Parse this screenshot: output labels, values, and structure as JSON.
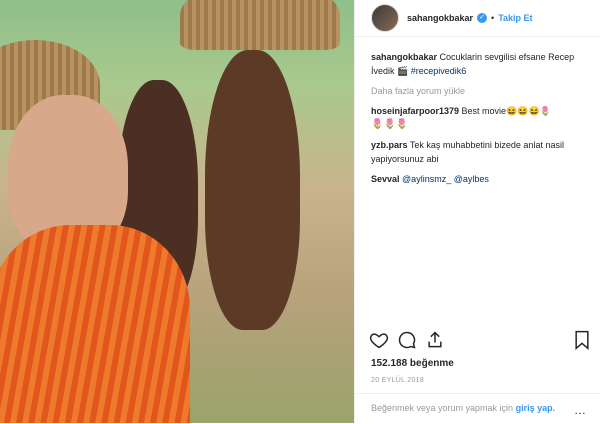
{
  "header": {
    "username": "sahangokbakar",
    "follow_label": "Takip Et"
  },
  "caption": {
    "username": "sahangokbakar",
    "text": "Cocuklarin sevgilisi efsane Recep İvedik",
    "emoji": "🎬",
    "hashtag": "#recepivedik6"
  },
  "load_more_label": "Daha fazla yorum yükle",
  "comments": [
    {
      "username": "hoseinjafarpoor1379",
      "text": "Best movie😆😆😆🌷",
      "extra": "🌷🌷🌷"
    },
    {
      "username": "yzb.pars",
      "text": "Tek kaş muhabbetini bizede anlat nasil yapiyorsunuz abi"
    },
    {
      "username": "Sevval",
      "mentions": "@aylinsmz_ @aylbes"
    }
  ],
  "likes": "152.188 beğenme",
  "date": "20 EYLÜL 2018",
  "footer": {
    "prompt": "Beğenmek veya yorum yapmak için",
    "login": "giriş yap."
  },
  "icons": [
    "heart-icon",
    "comment-icon",
    "share-icon",
    "bookmark-icon",
    "more-icon",
    "verified-icon"
  ]
}
